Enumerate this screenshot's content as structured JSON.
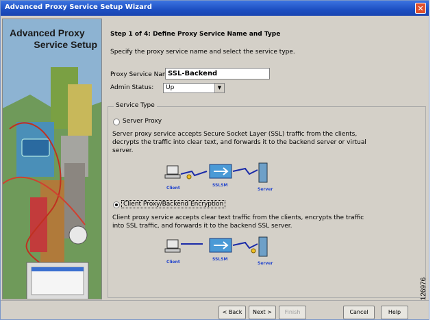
{
  "window": {
    "title": "Advanced Proxy Service Setup Wizard"
  },
  "sidebar": {
    "title_line1": "Advanced Proxy",
    "title_line2": "Service Setup"
  },
  "step": {
    "title": "Step 1 of 4: Define Proxy Service Name and Type",
    "description": "Specify the proxy service name and select the service type."
  },
  "form": {
    "name_label": "Proxy Service Name:",
    "name_value": "SSL-Backend",
    "status_label": "Admin Status:",
    "status_value": "Up"
  },
  "service_type": {
    "legend": "Service Type",
    "selected": "client",
    "server_proxy": {
      "label": "Server Proxy",
      "description": "Server proxy service accepts Secure Socket Layer (SSL) traffic from the clients, decrypts the traffic into clear text, and forwards it to the backend server or virtual server.",
      "diagram": {
        "client": "Client",
        "sslsm": "SSLSM",
        "server": "Server"
      }
    },
    "client_proxy": {
      "label": "Client Proxy/Backend Encryption",
      "description": "Client proxy service accepts clear text traffic from the clients, encrypts the traffic into SSL traffic, and forwards it to the backend SSL server.",
      "diagram": {
        "client": "Client",
        "sslsm": "SSLSM",
        "server": "Server"
      }
    }
  },
  "buttons": {
    "back": "< Back",
    "next": "Next >",
    "finish": "Finish",
    "cancel": "Cancel",
    "help": "Help"
  },
  "figure_number": "126976",
  "colors": {
    "titlebar": "#1d4fc2",
    "dialog_bg": "#d4d0c8",
    "diagram_label": "#2244cc"
  }
}
